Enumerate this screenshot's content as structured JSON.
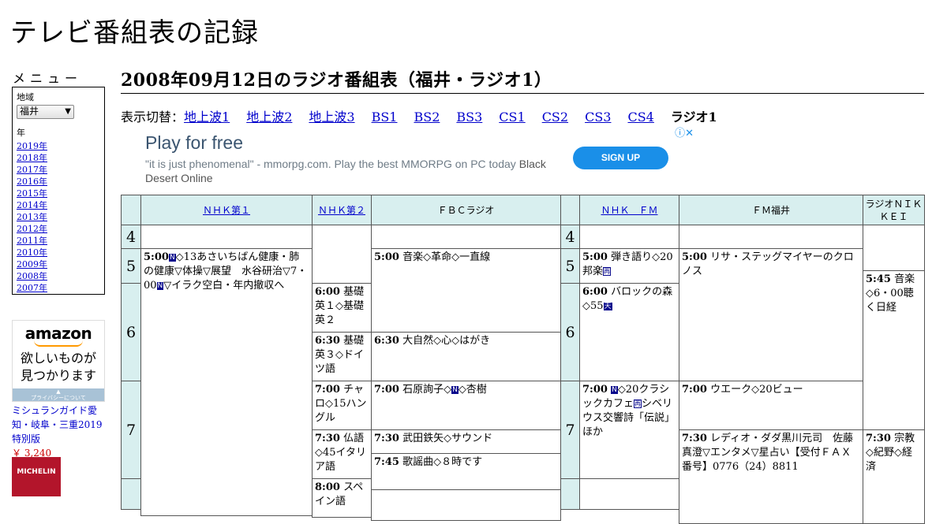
{
  "site": {
    "title": "テレビ番組表の記録"
  },
  "menu": {
    "title": "メニュー",
    "region_label": "地域",
    "region_value": "福井",
    "year_label": "年",
    "years": [
      "2019年",
      "2018年",
      "2017年",
      "2016年",
      "2015年",
      "2014年",
      "2013年",
      "2012年",
      "2011年",
      "2010年",
      "2009年",
      "2008年",
      "2007年"
    ]
  },
  "side_ad": {
    "brand": "amazon",
    "text_line1": "欲しいものが",
    "text_line2": "見つかります",
    "privacy": "プライバシーについて",
    "book_title": "ミシュランガイド愛知・岐阜・三重2019特別版",
    "price": "￥ 3,240",
    "cover_text": "MICHELIN"
  },
  "page": {
    "heading": "2008年09月12日のラジオ番組表（福井・ラジオ1）",
    "switch_label": "表示切替：",
    "switch_links": [
      "地上波1",
      "地上波2",
      "地上波3",
      "BS1",
      "BS2",
      "BS3",
      "CS1",
      "CS2",
      "CS3",
      "CS4"
    ],
    "switch_current": "ラジオ1"
  },
  "ad_banner": {
    "headline": "Play for free",
    "body": "\"it is just phenomenal\" - mmorpg.com. Play the best MMORPG on PC today",
    "body_brand": "Black Desert Online",
    "button": "SIGN UP",
    "icons": [
      "info-icon",
      "close-icon"
    ]
  },
  "schedule": {
    "channels": [
      "ＮＨＫ第１",
      "ＮＨＫ第２",
      "ＦＢＣラジオ",
      "ＮＨＫ　ＦＭ",
      "ＦＭ福井",
      "ラジオＮＩＫＫＥＩ"
    ],
    "hours": [
      "4",
      "5",
      "6",
      "7"
    ],
    "programs": {
      "nhk1_500": {
        "time": "5:00",
        "badge": "N",
        "text": "◇13あさいちばん健康・肺の健康▽体操▽展望　水谷研治▽7・00",
        "badge2": "N",
        "text2": "▽イラク空白・年内撤収へ"
      },
      "nhk2_600": {
        "time": "6:00",
        "text": "基礎英１◇基礎英２"
      },
      "nhk2_630": {
        "time": "6:30",
        "text": "基礎英３◇ドイツ語"
      },
      "nhk2_700": {
        "time": "7:00",
        "text": "チャロ◇15ハングル"
      },
      "nhk2_730": {
        "time": "7:30",
        "text": "仏語◇45イタリア語"
      },
      "nhk2_800": {
        "time": "8:00",
        "text": "スペイン語"
      },
      "fbc_500": {
        "time": "5:00",
        "text": "音楽◇革命◇一直線"
      },
      "fbc_630": {
        "time": "6:30",
        "text": "大自然◇心◇はがき"
      },
      "fbc_700": {
        "time": "7:00",
        "text": "石原詢子◇",
        "badge": "N",
        "text2": "◇杏樹"
      },
      "fbc_730": {
        "time": "7:30",
        "text": "武田鉄矢◇サウンド"
      },
      "fbc_745": {
        "time": "7:45",
        "text": "歌謡曲◇８時です"
      },
      "fm_500": {
        "time": "5:00",
        "text": "弾き語り◇20邦楽",
        "badge": "再"
      },
      "fm_600": {
        "time": "6:00",
        "text": "バロックの森◇55",
        "badge": "天"
      },
      "fm_700": {
        "time": "7:00",
        "badge": "N",
        "text": "◇20クラシックカフェ",
        "badge2": "再",
        "text2": "シベリウス交響詩「伝説」ほか"
      },
      "fmf_500": {
        "time": "5:00",
        "text": "リサ・ステッグマイヤーのクロノス"
      },
      "fmf_700": {
        "time": "7:00",
        "text": "ウエーク◇20ビュー"
      },
      "fmf_730": {
        "time": "7:30",
        "text": "レディオ・ダダ黒川元司　佐藤真澄▽エンタメ▽星占い【受付ＦＡＸ番号】0776（24）8811"
      },
      "nikkei_545": {
        "time": "5:45",
        "text": "音楽◇6・00聴く日経"
      },
      "nikkei_730": {
        "time": "7:30",
        "text": "宗教◇紀野◇経済"
      }
    }
  }
}
